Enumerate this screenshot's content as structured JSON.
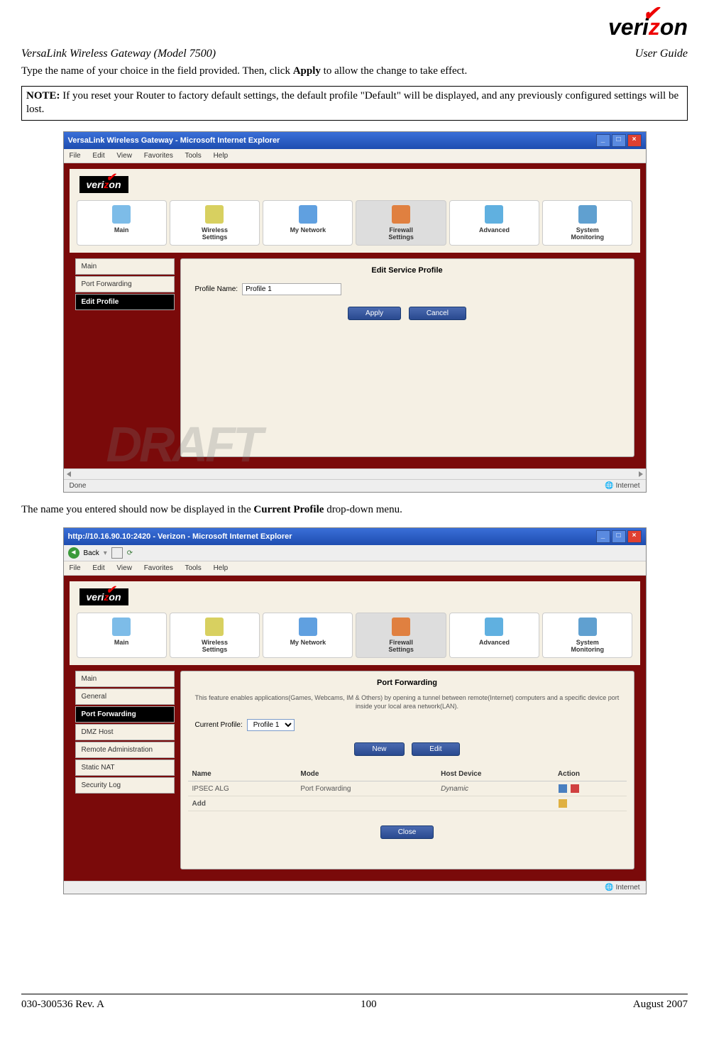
{
  "logo_text_pre": "veri",
  "logo_text_z": "z",
  "logo_text_post": "on",
  "header": {
    "left": "VersaLink Wireless Gateway (Model 7500)",
    "right": "User Guide"
  },
  "para1_pre": "Type the name of your choice in the field provided. Then, click ",
  "para1_bold": "Apply",
  "para1_post": " to allow the change to take effect.",
  "note_bold": "NOTE:",
  "note_text": " If you reset your Router to factory default settings, the default profile \"Default\" will be displayed, and any previously configured settings will be lost.",
  "shot1": {
    "title": "VersaLink Wireless Gateway - Microsoft Internet Explorer",
    "menu": [
      "File",
      "Edit",
      "View",
      "Favorites",
      "Tools",
      "Help"
    ],
    "nav": [
      "Main",
      "Wireless\nSettings",
      "My Network",
      "Firewall\nSettings",
      "Advanced",
      "System\nMonitoring"
    ],
    "side": [
      "Main",
      "Port Forwarding",
      "Edit Profile"
    ],
    "panel_title": "Edit Service Profile",
    "field_label": "Profile Name:",
    "field_value": "Profile 1",
    "btn_apply": "Apply",
    "btn_cancel": "Cancel",
    "status_left": "Done",
    "status_right": "Internet"
  },
  "para2_pre": "The name you entered should now be displayed in the ",
  "para2_bold": "Current Profile",
  "para2_post": " drop-down menu.",
  "shot2": {
    "title": "http://10.16.90.10:2420 - Verizon - Microsoft Internet Explorer",
    "back": "Back",
    "menu": [
      "File",
      "Edit",
      "View",
      "Favorites",
      "Tools",
      "Help"
    ],
    "nav": [
      "Main",
      "Wireless\nSettings",
      "My Network",
      "Firewall\nSettings",
      "Advanced",
      "System\nMonitoring"
    ],
    "side": [
      "Main",
      "General",
      "Port Forwarding",
      "DMZ Host",
      "Remote Administration",
      "Static NAT",
      "Security Log"
    ],
    "panel_title": "Port Forwarding",
    "panel_desc": "This feature enables applications(Games, Webcams, IM & Others) by opening a tunnel between remote(Internet) computers and a specific device port inside your local area network(LAN).",
    "field_label": "Current Profile:",
    "field_value": "Profile 1",
    "btn_new": "New",
    "btn_edit": "Edit",
    "btn_close": "Close",
    "table": {
      "headers": [
        "Name",
        "Mode",
        "Host Device",
        "Action"
      ],
      "row1": [
        "IPSEC ALG",
        "Port Forwarding",
        "Dynamic"
      ],
      "add": "Add"
    },
    "status_right": "Internet"
  },
  "draft": "DRAFT",
  "footer": {
    "left": "030-300536 Rev. A",
    "center": "100",
    "right": "August 2007"
  }
}
